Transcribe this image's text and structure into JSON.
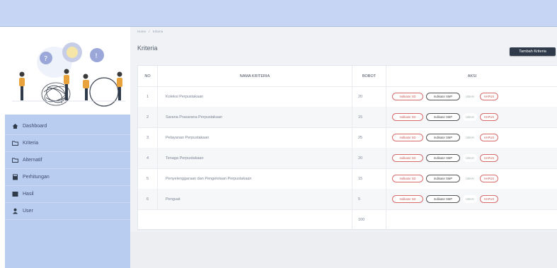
{
  "breadcrumb": [
    "Home",
    "/",
    "Kriteria"
  ],
  "page_title": "Kriteria",
  "add_button": "Tambah Kriteria",
  "sidebar": {
    "items": [
      {
        "label": "Dashboard",
        "icon": "home-icon"
      },
      {
        "label": "Kriteria",
        "icon": "folder-icon"
      },
      {
        "label": "Alternatif",
        "icon": "folder-icon"
      },
      {
        "label": "Perhitungan",
        "icon": "calculator-icon"
      },
      {
        "label": "Hasil",
        "icon": "chart-icon"
      },
      {
        "label": "User",
        "icon": "user-icon"
      }
    ]
  },
  "table": {
    "headers": [
      "NO",
      "NAMA KRITERIA",
      "BOBOT",
      "AKSI"
    ],
    "rows": [
      {
        "no": "1",
        "nama": "Koleksi Perpustakaan",
        "bobot": "20"
      },
      {
        "no": "2",
        "nama": "Sarana Prasarana Perpustakaan",
        "bobot": "15"
      },
      {
        "no": "3",
        "nama": "Pelayanan Perpustakaan",
        "bobot": "25"
      },
      {
        "no": "4",
        "nama": "Tenaga Perpustakaan",
        "bobot": "20"
      },
      {
        "no": "5",
        "nama": "Penyelenggaraan dan Pengelolaan Perpustakaan",
        "bobot": "15"
      },
      {
        "no": "6",
        "nama": "Penguat",
        "bobot": "5"
      }
    ],
    "total": "100",
    "actions": {
      "sd": "Indikator SD",
      "smp": "Indikator SMP",
      "ubah": "UBAH",
      "hapus": "HAPUS"
    }
  },
  "colors": {
    "topbar": "#c7d5f4",
    "sidebar_menu": "#b9cdf1",
    "button_dark": "#2f3a4a",
    "action_red": "#c95555"
  }
}
